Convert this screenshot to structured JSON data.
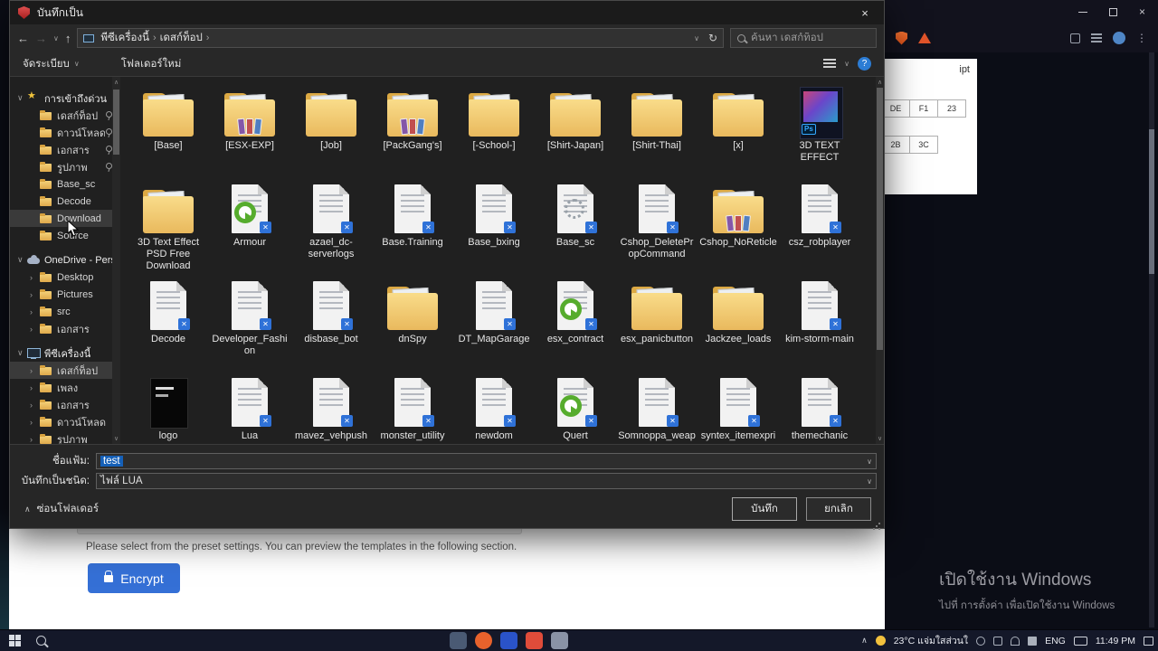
{
  "dialog": {
    "title": "บันทึกเป็น",
    "close": "×",
    "breadcrumb": [
      "พีซีเครื่องนี้",
      "เดสก์ท็อป"
    ],
    "search_placeholder": "ค้นหา เดสก์ท็อป",
    "toolbar": {
      "organize": "จัดระเบียบ",
      "new_folder": "โฟลเดอร์ใหม่"
    },
    "filename_label": "ชื่อแฟ้ม:",
    "filename_value": "test",
    "filetype_label": "บันทึกเป็นชนิด:",
    "filetype_value": "ไฟล์ LUA",
    "save_label": "บันทึก",
    "cancel_label": "ยกเลิก",
    "hide_folders_label": "ซ่อนโฟลเดอร์"
  },
  "sidebar": {
    "sections": [
      {
        "label": "การเข้าถึงด่วน",
        "icon": "star",
        "items": [
          {
            "label": "เดสก์ท็อป",
            "pinned": true
          },
          {
            "label": "ดาวน์โหลด",
            "pinned": true
          },
          {
            "label": "เอกสาร",
            "pinned": true
          },
          {
            "label": "รูปภาพ",
            "pinned": true
          },
          {
            "label": "Base_sc"
          },
          {
            "label": "Decode"
          },
          {
            "label": "Download",
            "selected": true
          },
          {
            "label": "Source"
          }
        ]
      },
      {
        "label": "OneDrive - Person",
        "icon": "cloud",
        "items": [
          {
            "label": "Desktop"
          },
          {
            "label": "Pictures"
          },
          {
            "label": "src"
          },
          {
            "label": "เอกสาร"
          }
        ]
      },
      {
        "label": "พีซีเครื่องนี้",
        "icon": "pc",
        "items": [
          {
            "label": "เดสก์ท็อป",
            "selected": true
          },
          {
            "label": "เพลง"
          },
          {
            "label": "เอกสาร"
          },
          {
            "label": "ดาวน์โหลด"
          },
          {
            "label": "รูปภาพ"
          }
        ]
      }
    ]
  },
  "files": [
    {
      "name": "[Base]",
      "icon": "folder"
    },
    {
      "name": "[ESX-EXP]",
      "icon": "folder-rar"
    },
    {
      "name": "[Job]",
      "icon": "folder"
    },
    {
      "name": "[PackGang's]",
      "icon": "folder-rar"
    },
    {
      "name": "[-School-]",
      "icon": "folder"
    },
    {
      "name": "[Shirt-Japan]",
      "icon": "folder"
    },
    {
      "name": "[Shirt-Thai]",
      "icon": "folder"
    },
    {
      "name": "[x]",
      "icon": "folder"
    },
    {
      "name": "3D TEXT EFFECT",
      "icon": "psd"
    },
    {
      "name": "3D Text Effect PSD Free Download",
      "icon": "folder"
    },
    {
      "name": "Armour",
      "icon": "hs"
    },
    {
      "name": "azael_dc-serverlogs",
      "icon": "doc"
    },
    {
      "name": "Base.Training",
      "icon": "doc"
    },
    {
      "name": "Base_bxing",
      "icon": "doc"
    },
    {
      "name": "Base_sc",
      "icon": "gear"
    },
    {
      "name": "Cshop_DeletePropCommand",
      "icon": "doc"
    },
    {
      "name": "Cshop_NoReticle",
      "icon": "folder-rar"
    },
    {
      "name": "csz_robplayer",
      "icon": "doc"
    },
    {
      "name": "Decode",
      "icon": "doc"
    },
    {
      "name": "Developer_Fashion",
      "icon": "doc"
    },
    {
      "name": "disbase_bot",
      "icon": "doc"
    },
    {
      "name": "dnSpy",
      "icon": "folder"
    },
    {
      "name": "DT_MapGarage",
      "icon": "doc"
    },
    {
      "name": "esx_contract",
      "icon": "hs"
    },
    {
      "name": "esx_panicbutton",
      "icon": "folder"
    },
    {
      "name": "Jackzee_loads",
      "icon": "folder"
    },
    {
      "name": "kim-storm-main",
      "icon": "doc"
    },
    {
      "name": "logo",
      "icon": "dark"
    },
    {
      "name": "Lua",
      "icon": "doc"
    },
    {
      "name": "mavez_vehpush",
      "icon": "doc"
    },
    {
      "name": "monster_utility",
      "icon": "doc"
    },
    {
      "name": "newdom",
      "icon": "doc"
    },
    {
      "name": "Quert",
      "icon": "hs"
    },
    {
      "name": "Somnoppa_weap",
      "icon": "doc"
    },
    {
      "name": "syntex_itemexpri",
      "icon": "doc"
    },
    {
      "name": "themechanic",
      "icon": "doc"
    }
  ],
  "webpage": {
    "hint_text": "Please select from the preset settings. You can preview the templates in the following section.",
    "encrypt_label": "Encrypt",
    "card_label": "ipt",
    "table_rows": [
      [
        "DE",
        "F1",
        "23"
      ],
      [
        "2B",
        "3C"
      ]
    ]
  },
  "watermark": {
    "line1": "เปิดใช้งาน Windows",
    "line2": "ไปที่ การตั้งค่า เพื่อเปิดใช้งาน Windows"
  },
  "taskbar": {
    "weather": "23°C แจ่มใสส่วนใ",
    "lang": "ENG",
    "time": "11:49 PM"
  }
}
